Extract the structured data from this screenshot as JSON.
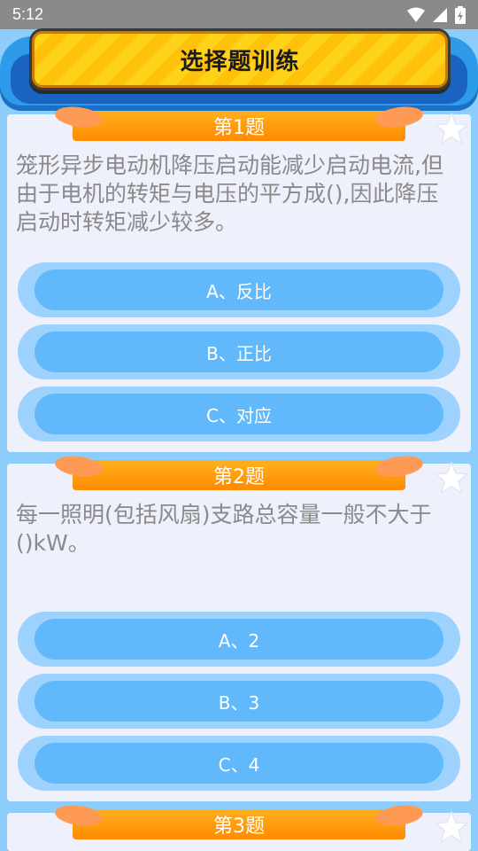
{
  "status": {
    "time": "5:12"
  },
  "header": {
    "title": "选择题训练"
  },
  "questions": [
    {
      "tab": "第1题",
      "text": "笼形异步电动机降压启动能减少启动电流,但由于电机的转矩与电压的平方成(),因此降压启动时转矩减少较多。",
      "options": [
        "A、反比",
        "B、正比",
        "C、对应"
      ]
    },
    {
      "tab": "第2题",
      "text": "每一照明(包括风扇)支路总容量一般不大于()kW。",
      "options": [
        "A、2",
        "B、3",
        "C、4"
      ]
    },
    {
      "tab": "第3题"
    }
  ],
  "colors": {
    "accent": "#ff8a00",
    "option_outer": "#9dd2ff",
    "option_inner": "#61b8fb",
    "header_plate": "#ffd21a"
  }
}
